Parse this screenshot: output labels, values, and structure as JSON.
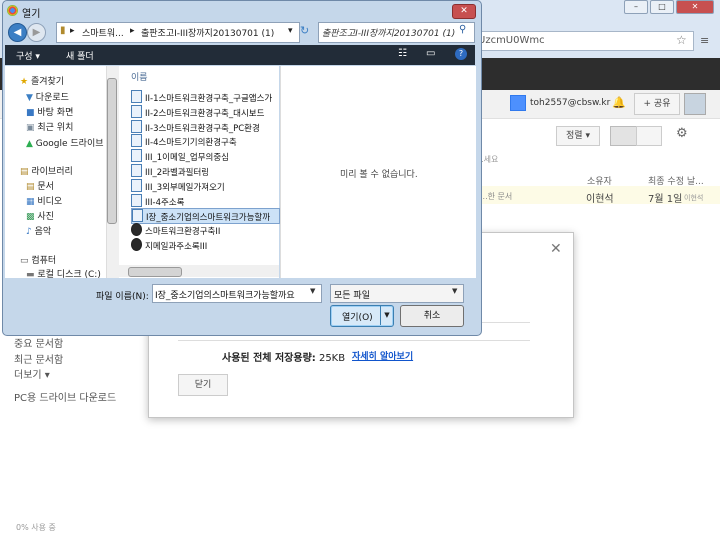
{
  "browser": {
    "url_fragment": "UzcmU0Wmc",
    "window_controls": [
      "–",
      "□",
      "✕"
    ]
  },
  "drive": {
    "account": "toh2557@cbsw.kr",
    "share_label": "공유",
    "sort_label": "정렬",
    "column_note": "...세요",
    "column_owner": "소유자",
    "column_modified": "최종 수정 날...",
    "file_row": {
      "type": "...한 문서",
      "owner": "이현석",
      "date": "7월 1일",
      "by": "이현석"
    },
    "sidebar": [
      "중요 문서함",
      "최근 문서함",
      "더보기 ▾",
      "PC용 드라이브 다운로드"
    ],
    "storage_used": "0% 사용 중"
  },
  "storage_modal": {
    "usage_label": "사용된 전체 저장용량:",
    "usage_value": "25KB",
    "detail_link": "자세히 알아보기",
    "close_label": "닫기"
  },
  "dialog": {
    "title": "열기",
    "breadcrumbs": [
      "스마트워...",
      "출판조고I-III장까지20130701 (1)"
    ],
    "search_text": "출판조고I-III장까지20130701 (1)",
    "toolbar": {
      "organize": "구성 ▾",
      "new_folder": "새 폴더"
    },
    "nav_items": [
      {
        "label": "즐겨찾기",
        "icon": "star-icon",
        "glyph": "★",
        "color": "#e0a800",
        "indent": 0
      },
      {
        "label": "다운로드",
        "icon": "download-folder-icon",
        "glyph": "▼",
        "color": "#3c7fc4",
        "indent": 1
      },
      {
        "label": "바탕 화면",
        "icon": "desktop-icon",
        "glyph": "■",
        "color": "#3a79c4",
        "indent": 1
      },
      {
        "label": "최근 위치",
        "icon": "recent-places-icon",
        "glyph": "▣",
        "color": "#7a8a9a",
        "indent": 1
      },
      {
        "label": "Google 드라이브",
        "icon": "google-drive-icon",
        "glyph": "▲",
        "color": "#2eae52",
        "indent": 1
      },
      {
        "label": "라이브러리",
        "icon": "library-icon",
        "glyph": "▤",
        "color": "#b08a2e",
        "indent": 0
      },
      {
        "label": "문서",
        "icon": "documents-icon",
        "glyph": "▤",
        "color": "#b08a2e",
        "indent": 1
      },
      {
        "label": "비디오",
        "icon": "videos-icon",
        "glyph": "▦",
        "color": "#3a79c4",
        "indent": 1
      },
      {
        "label": "사진",
        "icon": "pictures-icon",
        "glyph": "▩",
        "color": "#3a9a5a",
        "indent": 1
      },
      {
        "label": "음악",
        "icon": "music-icon",
        "glyph": "♪",
        "color": "#3a79c4",
        "indent": 1
      },
      {
        "label": "컴퓨터",
        "icon": "computer-icon",
        "glyph": "▭",
        "color": "#555555",
        "indent": 0
      },
      {
        "label": "로컬 디스크 (C:)",
        "icon": "local-disk-icon",
        "glyph": "▬",
        "color": "#777777",
        "indent": 1
      }
    ],
    "name_header": "이름",
    "files": [
      {
        "name": "II-1스마트워크환경구축_구글앱스가",
        "type": "doc"
      },
      {
        "name": "II-2스마트워크환경구축_대시보드",
        "type": "doc"
      },
      {
        "name": "II-3스마트워크환경구축_PC환경",
        "type": "doc"
      },
      {
        "name": "II-4스마트기기의환경구축",
        "type": "doc"
      },
      {
        "name": "III_1이메일_업무의중심",
        "type": "doc"
      },
      {
        "name": "III_2라벨과필터링",
        "type": "doc"
      },
      {
        "name": "III_3외부메일가져오기",
        "type": "doc"
      },
      {
        "name": "III-4주소록",
        "type": "doc"
      },
      {
        "name": "I장_중소기업의스마트워크가능할까",
        "type": "doc",
        "selected": true
      },
      {
        "name": "스마트워크환경구축II",
        "type": "hwp"
      },
      {
        "name": "지메일과주소록III",
        "type": "hwp"
      }
    ],
    "preview_text": "미리 볼 수 없습니다.",
    "filename_label": "파일 이름(N):",
    "filename_value": "I장_중소기업의스마트워크가능할까요",
    "filetype_value": "모든 파일",
    "open_label": "열기(O)",
    "cancel_label": "취소"
  }
}
